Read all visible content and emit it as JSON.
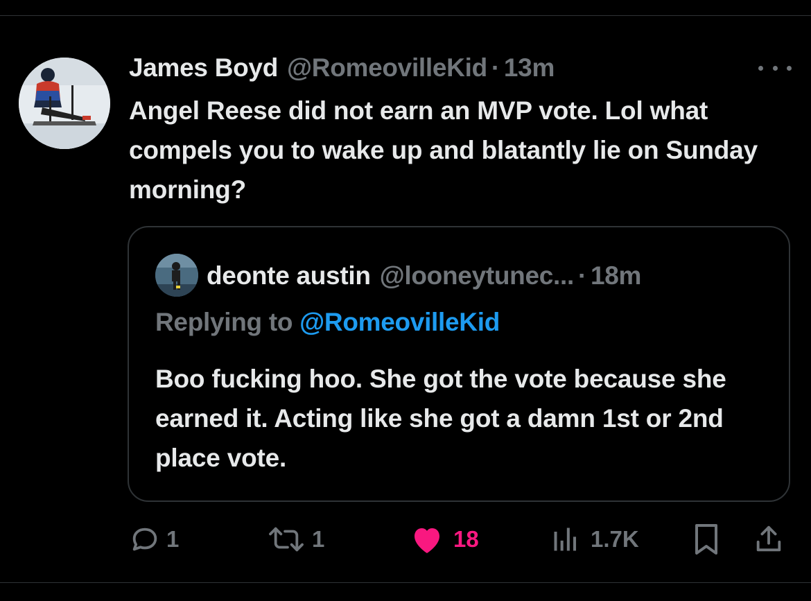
{
  "tweet": {
    "author_name": "James Boyd",
    "author_handle": "@RomeovilleKid",
    "separator": "·",
    "time": "13m",
    "text": "Angel Reese did not earn an MVP vote. Lol what compels you to wake up and blatantly lie on Sunday morning?"
  },
  "quoted": {
    "author_name": "deonte austin",
    "author_handle": "@looneytunec...",
    "separator": "·",
    "time": "18m",
    "replying_prefix": "Replying to ",
    "replying_handle": "@RomeovilleKid",
    "text": "Boo fucking hoo. She got the vote because she earned it. Acting like she got a damn 1st or 2nd place vote."
  },
  "actions": {
    "reply_count": "1",
    "retweet_count": "1",
    "like_count": "18",
    "views_count": "1.7K"
  },
  "icons": {
    "more": "more-dots-icon",
    "reply": "reply-bubble-icon",
    "retweet": "retweet-icon",
    "like": "heart-icon",
    "views": "views-bars-icon",
    "bookmark": "bookmark-icon",
    "share": "share-icon"
  },
  "colors": {
    "background": "#000000",
    "text_primary": "#e7e9ea",
    "text_secondary": "#71767b",
    "link_blue": "#1d9bf0",
    "like_pink": "#f91880",
    "border": "#2f3336"
  }
}
